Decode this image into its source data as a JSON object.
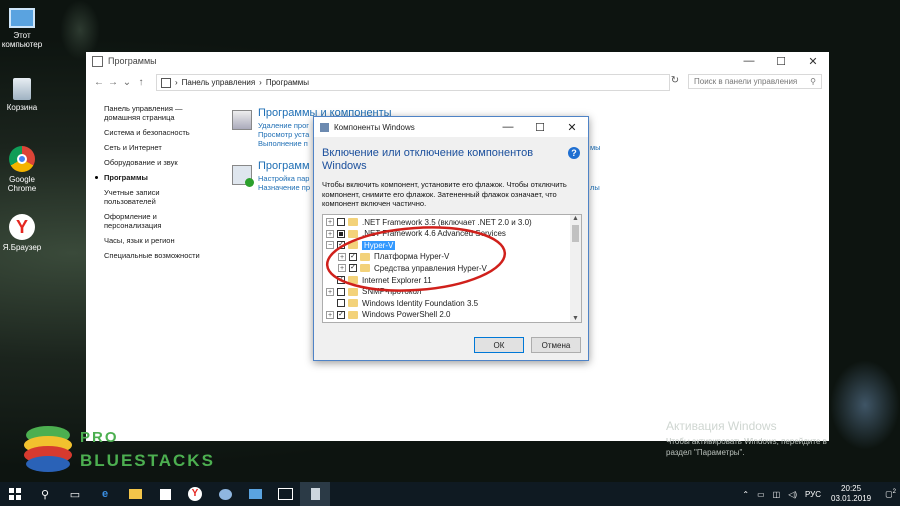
{
  "desktop": {
    "icons": [
      {
        "label": "Этот\nкомпьютер",
        "icon": "computer-icon"
      },
      {
        "label": "Корзина",
        "icon": "recycle-bin-icon"
      },
      {
        "label": "Google\nChrome",
        "icon": "chrome-icon"
      },
      {
        "label": "Я.Браузер",
        "icon": "yandex-browser-icon"
      }
    ],
    "activation": {
      "title": "Активация Windows",
      "line1": "Чтобы активировать Windows, перейдите в",
      "line2": "раздел \"Параметры\"."
    },
    "logo": {
      "top": "PRO",
      "bottom": "BLUESTACKS"
    }
  },
  "control_panel": {
    "title": "Программы",
    "controls": {
      "minimize": "—",
      "maximize": "☐",
      "close": "✕"
    },
    "breadcrumb": [
      "Панель управления",
      "Программы"
    ],
    "search_placeholder": "Поиск в панели управления",
    "nav": [
      "Панель управления —\nдомашняя страница",
      "Система и безопасность",
      "Сеть и Интернет",
      "Оборудование и звук",
      "Программы",
      "Учетные записи\nпользователей",
      "Оформление и\nперсонализация",
      "Часы, язык и регион",
      "Специальные возможности"
    ],
    "active_nav_index": 4,
    "sections": [
      {
        "heading": "Программы и компоненты",
        "links": [
          "Удаление прог",
          "Просмотр уста",
          "Выполнение п"
        ],
        "side_link": "мы"
      },
      {
        "heading": "Программ",
        "links": [
          "Настройка пар",
          "Назначение пр"
        ],
        "side_link": "лы"
      }
    ]
  },
  "dialog": {
    "title": "Компоненты Windows",
    "heading": "Включение или отключение компонентов Windows",
    "description": "Чтобы включить компонент, установите его флажок. Чтобы отключить компонент, снимите его флажок. Затененный флажок означает, что компонент включен частично.",
    "items": [
      {
        "label": ".NET Framework 3.5 (включает .NET 2.0 и 3.0)",
        "level": 0,
        "expander": "+",
        "state": "unchecked",
        "selected": false
      },
      {
        "label": ".NET Framework 4.6 Advanced Services",
        "level": 0,
        "expander": "+",
        "state": "partial",
        "selected": false
      },
      {
        "label": "Hyper-V",
        "level": 0,
        "expander": "−",
        "state": "checked",
        "selected": true
      },
      {
        "label": "Платформа Hyper-V",
        "level": 1,
        "expander": "+",
        "state": "checked",
        "selected": false
      },
      {
        "label": "Средства управления Hyper-V",
        "level": 1,
        "expander": "+",
        "state": "checked",
        "selected": false
      },
      {
        "label": "Internet Explorer 11",
        "level": 0,
        "expander": "",
        "state": "checked",
        "selected": false
      },
      {
        "label": "SNMP-протокол",
        "level": 0,
        "expander": "+",
        "state": "unchecked",
        "selected": false
      },
      {
        "label": "Windows Identity Foundation 3.5",
        "level": 0,
        "expander": "",
        "state": "unchecked",
        "selected": false
      },
      {
        "label": "Windows PowerShell 2.0",
        "level": 0,
        "expander": "+",
        "state": "checked",
        "selected": false
      }
    ],
    "ok_label": "ОК",
    "cancel_label": "Отмена"
  },
  "taskbar": {
    "language": "РУС",
    "time": "20:25",
    "date": "03.01.2019",
    "notification_count": "2"
  },
  "colors": {
    "link": "#1f6fb5",
    "heading": "#1b4f9c",
    "selection": "#3399ff",
    "annotation": "#d0201b",
    "logo": "#4caf50"
  }
}
